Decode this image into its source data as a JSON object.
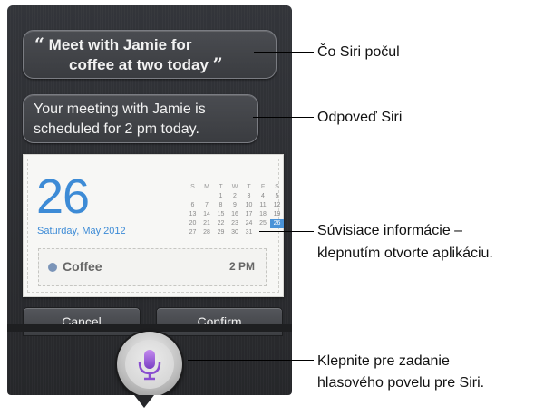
{
  "siri": {
    "heard_line1": "Meet with Jamie for",
    "heard_line2": "coffee at two today",
    "open_quote": "“",
    "close_quote": "”",
    "reply_line1": "Your meeting with Jamie is",
    "reply_line2": "scheduled for 2 pm today."
  },
  "calendar": {
    "day": "26",
    "date_text": "Saturday, May 2012",
    "weekdays": [
      "S",
      "M",
      "T",
      "W",
      "T",
      "F",
      "S"
    ],
    "weeks": [
      [
        "",
        "",
        "1",
        "2",
        "3",
        "4",
        "5"
      ],
      [
        "6",
        "7",
        "8",
        "9",
        "10",
        "11",
        "12"
      ],
      [
        "13",
        "14",
        "15",
        "16",
        "17",
        "18",
        "19"
      ],
      [
        "20",
        "21",
        "22",
        "23",
        "24",
        "25",
        "26"
      ],
      [
        "27",
        "28",
        "29",
        "30",
        "31",
        "",
        ""
      ]
    ],
    "today": "26",
    "event_name": "Coffee",
    "event_time": "2 PM",
    "accent_color": "#3d8bd6"
  },
  "buttons": {
    "cancel": "Cancel",
    "confirm": "Confirm"
  },
  "mic": {
    "icon": "microphone-icon"
  },
  "callouts": {
    "heard": "Čo Siri počul",
    "reply": "Odpoveď Siri",
    "related_line1": "Súvisiace informácie –",
    "related_line2": "klepnutím otvorte aplikáciu.",
    "mic_line1": "Klepnite pre zadanie",
    "mic_line2": "hlasového povelu pre Siri."
  }
}
